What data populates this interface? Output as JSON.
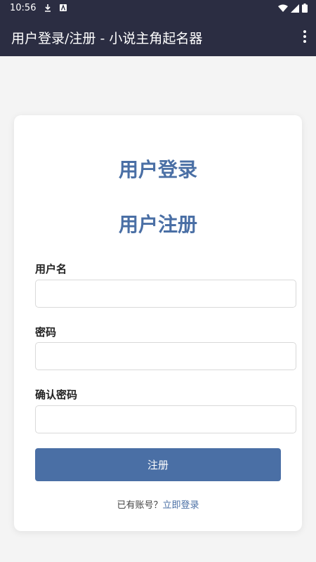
{
  "status_bar": {
    "time": "10:56",
    "icons": [
      "download-icon",
      "a-badge-icon",
      "wifi-icon",
      "signal-icon",
      "battery-icon"
    ]
  },
  "app_bar": {
    "title": "用户登录/注册 - 小说主角起名器",
    "menu_icon": "more-vert-icon"
  },
  "card": {
    "login_heading": "用户登录",
    "register_heading": "用户注册",
    "fields": {
      "username": {
        "label": "用户名",
        "value": "",
        "placeholder": ""
      },
      "password": {
        "label": "密码",
        "value": "",
        "placeholder": ""
      },
      "confirm": {
        "label": "确认密码",
        "value": "",
        "placeholder": ""
      }
    },
    "submit_label": "注册",
    "footer_prompt": "已有账号？",
    "footer_link": "立即登录"
  },
  "colors": {
    "app_bar": "#2b2d42",
    "accent": "#4a6fa5",
    "background": "#f4f4f4",
    "card": "#ffffff"
  }
}
